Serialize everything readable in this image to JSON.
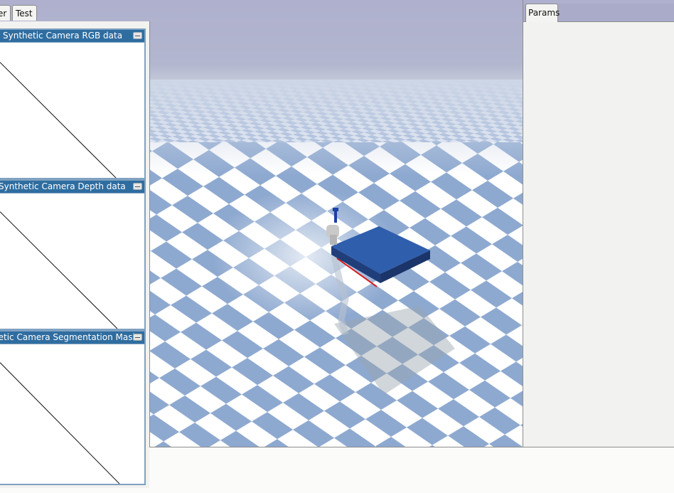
{
  "left_tabs": [
    {
      "label": "er"
    },
    {
      "label": "Test"
    }
  ],
  "camera_windows": {
    "rgb": {
      "title": "Synthetic Camera RGB data"
    },
    "depth": {
      "title": "Synthetic Camera Depth data"
    },
    "segmentation": {
      "title": "Synthetic Camera Segmentation Mask"
    }
  },
  "right_panel": {
    "tab_label": "Params"
  },
  "colors": {
    "sky": "#aeb0cd",
    "floor_blue": "#8faad0",
    "floor_white": "#ffffff",
    "cube": "#2a58a6",
    "titlebar": "#2f6da0"
  }
}
